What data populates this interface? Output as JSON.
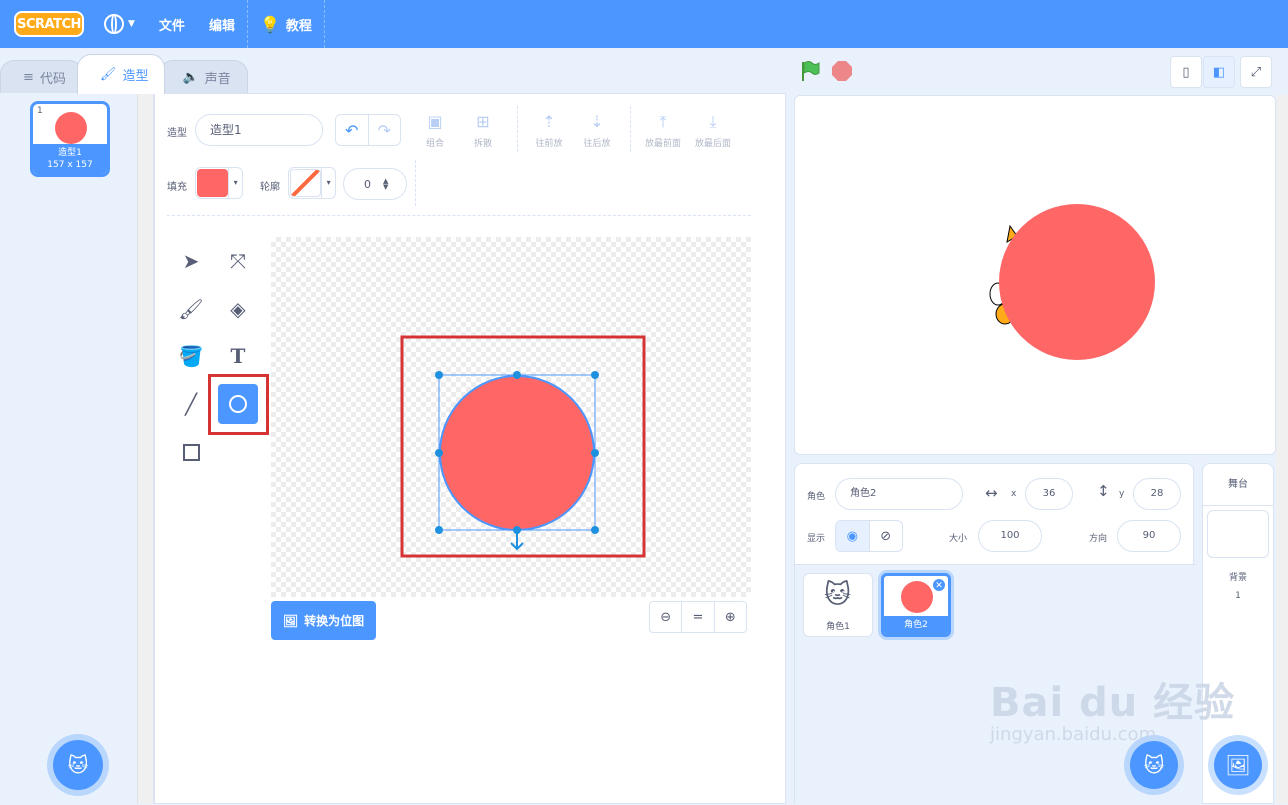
{
  "menubar": {
    "logo": "SCRATCH",
    "file": "文件",
    "edit": "编辑",
    "tutorials": "教程"
  },
  "tabs": {
    "code": "代码",
    "costumes": "造型",
    "sounds": "声音"
  },
  "costume_list": {
    "items": [
      {
        "number": "1",
        "name": "造型1",
        "size": "157 x 157",
        "color": "#ff6666"
      }
    ]
  },
  "paint_editor": {
    "costume_label": "造型",
    "costume_name": "造型1",
    "group": "组合",
    "ungroup": "拆散",
    "forward": "往前放",
    "backward": "往后放",
    "front": "放最前面",
    "back": "放最后面",
    "fill_label": "填充",
    "fill_color": "#ff6666",
    "outline_label": "轮廓",
    "outline_width": "0",
    "convert_button": "转换为位图",
    "selected_tool": "circle"
  },
  "sprite_info": {
    "sprite_label": "角色",
    "sprite_name": "角色2",
    "x_label": "x",
    "x_value": "36",
    "y_label": "y",
    "y_value": "28",
    "show_label": "显示",
    "size_label": "大小",
    "size_value": "100",
    "direction_label": "方向",
    "direction_value": "90"
  },
  "sprites": [
    {
      "name": "角色1",
      "selected": false
    },
    {
      "name": "角色2",
      "selected": true
    }
  ],
  "stage_selector": {
    "title": "舞台",
    "backdrops_label": "背景",
    "backdrops_count": "1"
  },
  "watermark": {
    "brand": "Bai du 经验",
    "url": "jingyan.baidu.com"
  },
  "colors": {
    "accent": "#4c97ff",
    "shape": "#ff6666",
    "highlight": "#d63434"
  }
}
